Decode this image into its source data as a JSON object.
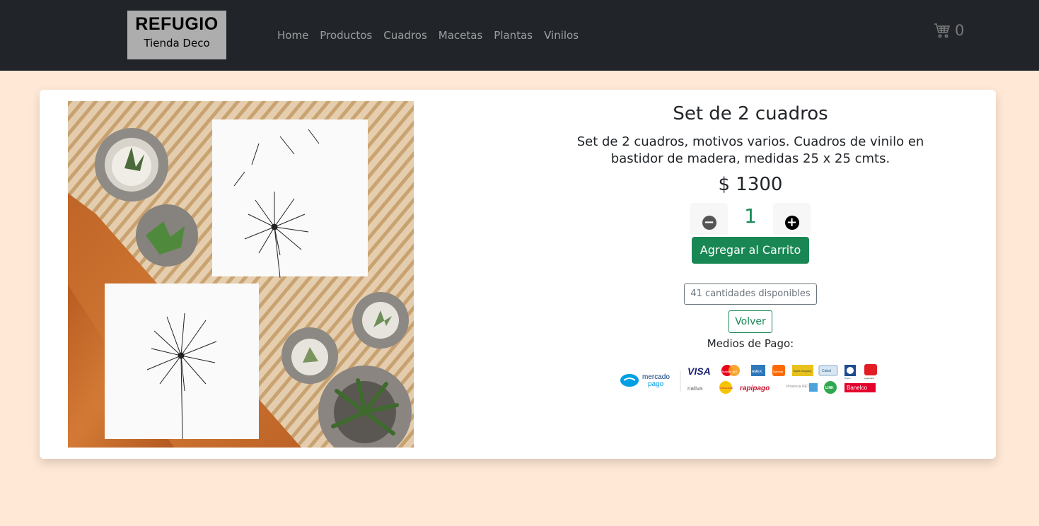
{
  "brand": {
    "title": "REFUGIO",
    "subtitle": "Tienda Deco"
  },
  "nav": {
    "links": [
      "Home",
      "Productos",
      "Cuadros",
      "Macetas",
      "Plantas",
      "Vinilos"
    ]
  },
  "cart": {
    "icon": "cart-icon",
    "count": "0"
  },
  "product": {
    "title": "Set de 2 cuadros",
    "description": "Set de 2 cuadros, motivos varios. Cuadros de vinilo en bastidor de madera, medidas 25 x 25 cmts.",
    "price": "$ 1300",
    "quantity": "1",
    "add_to_cart_label": "Agregar al Carrito",
    "stock_label": "41 cantidades disponibles",
    "back_label": "Volver",
    "payment_label": "Medios de Pago:"
  },
  "payment_logos": {
    "mercadopago": [
      "mercado",
      "pago"
    ],
    "row1": [
      "VISA",
      "MasterCard",
      "AMEX",
      "Naranja",
      "Tarjeta Shopping",
      "Cabal",
      "Diners",
      "Argencard"
    ],
    "row2": [
      "nativa",
      "Cencosud",
      "rapipago",
      "Provincia NET",
      "LINK",
      "Banelco"
    ]
  },
  "colors": {
    "navbar_bg": "#212529",
    "page_bg": "#ffe8d6",
    "success": "#198754",
    "brand_bg": "#adadad"
  }
}
